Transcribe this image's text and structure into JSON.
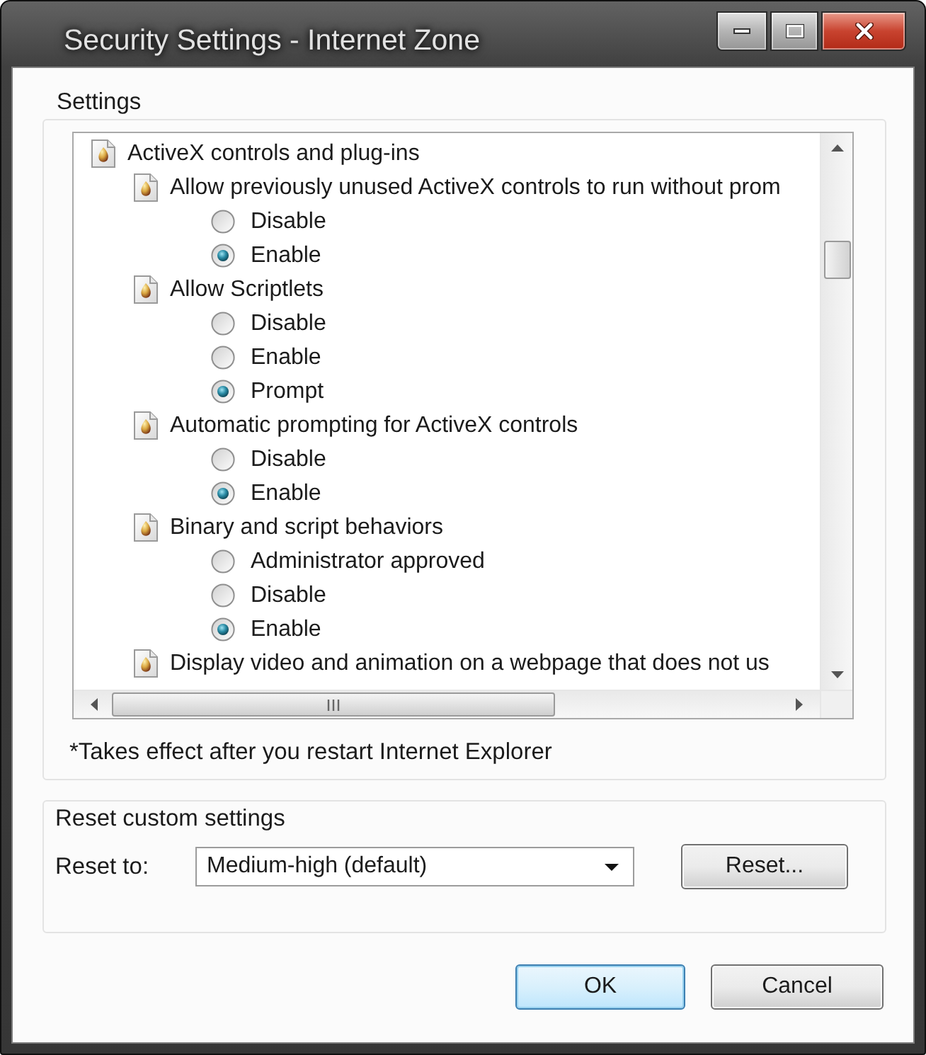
{
  "window": {
    "title": "Security Settings - Internet Zone"
  },
  "settings": {
    "label": "Settings",
    "tree": [
      {
        "label": "ActiveX controls and plug-ins",
        "children": [
          {
            "label": "Allow previously unused ActiveX controls to run without prom",
            "options": [
              {
                "label": "Disable",
                "selected": false
              },
              {
                "label": "Enable",
                "selected": true
              }
            ]
          },
          {
            "label": "Allow Scriptlets",
            "options": [
              {
                "label": "Disable",
                "selected": false
              },
              {
                "label": "Enable",
                "selected": false
              },
              {
                "label": "Prompt",
                "selected": true
              }
            ]
          },
          {
            "label": "Automatic prompting for ActiveX controls",
            "options": [
              {
                "label": "Disable",
                "selected": false
              },
              {
                "label": "Enable",
                "selected": true
              }
            ]
          },
          {
            "label": "Binary and script behaviors",
            "options": [
              {
                "label": "Administrator approved",
                "selected": false
              },
              {
                "label": "Disable",
                "selected": false
              },
              {
                "label": "Enable",
                "selected": true
              }
            ]
          },
          {
            "label": "Display video and animation on a webpage that does not us"
          }
        ]
      }
    ],
    "note": "*Takes effect after you restart Internet Explorer"
  },
  "reset": {
    "label": "Reset custom settings",
    "field_label": "Reset to:",
    "dropdown": {
      "value": "Medium-high (default)"
    },
    "button": {
      "label": "Reset..."
    }
  },
  "buttons": [
    {
      "label": "OK",
      "default": true
    },
    {
      "label": "Cancel",
      "default": false
    }
  ]
}
